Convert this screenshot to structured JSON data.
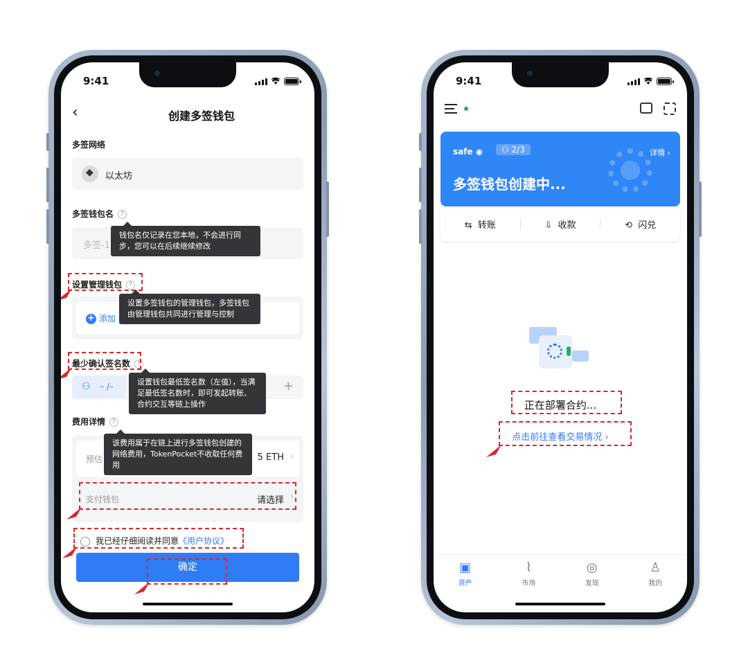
{
  "status": {
    "time": "9:41"
  },
  "left": {
    "nav_title": "创建多签钱包",
    "network_label": "多签网络",
    "network_value": "以太坊",
    "name_label": "多签钱包名",
    "name_placeholder": "多签-1",
    "name_tooltip": "钱包名仅记录在您本地，不会进行同步，您可以在后续继续修改",
    "manager_label": "设置管理钱包",
    "manager_add": "添加",
    "manager_tooltip": "设置多签钱包的管理钱包，多签钱包由管理钱包共同进行管理与控制",
    "min_sign_label": "最少确认签名数",
    "min_sign_value": "– /–",
    "min_sign_plus": "+",
    "min_sign_tooltip": "设置钱包最低签名数（左值），当满足最低签名数时，即可发起转账、合约交互等链上操作",
    "fee_label": "费用详情",
    "fee_estimate": "预估",
    "fee_value": "5 ETH",
    "fee_tooltip": "该费用属于在链上进行多签钱包创建的网络费用，TokenPocket不收取任何费用",
    "pay_wallet_label": "支付钱包",
    "pay_wallet_value": "请选择",
    "agree_text": "我已经仔细阅读并同意",
    "agree_link": "《用户协议》",
    "confirm_label": "确定"
  },
  "right": {
    "card_safe": "safe",
    "card_badge": "2/3",
    "card_detail": "详情",
    "card_title": "多签钱包创建中...",
    "actions": [
      {
        "icon": "⇆",
        "label": "转账"
      },
      {
        "icon": "⇩",
        "label": "收款"
      },
      {
        "icon": "⟲",
        "label": "闪兑"
      }
    ],
    "deploying": "正在部署合约...",
    "view_tx": "点击前往查看交易情况",
    "tabs": [
      {
        "icon": "▣",
        "label": "资产"
      },
      {
        "icon": "⌇",
        "label": "市场"
      },
      {
        "icon": "◎",
        "label": "发现"
      },
      {
        "icon": "♙",
        "label": "我的"
      }
    ]
  },
  "colors": {
    "accent": "#2f7cf6",
    "card": "#2f86f6",
    "annotation": "#d9262b"
  }
}
